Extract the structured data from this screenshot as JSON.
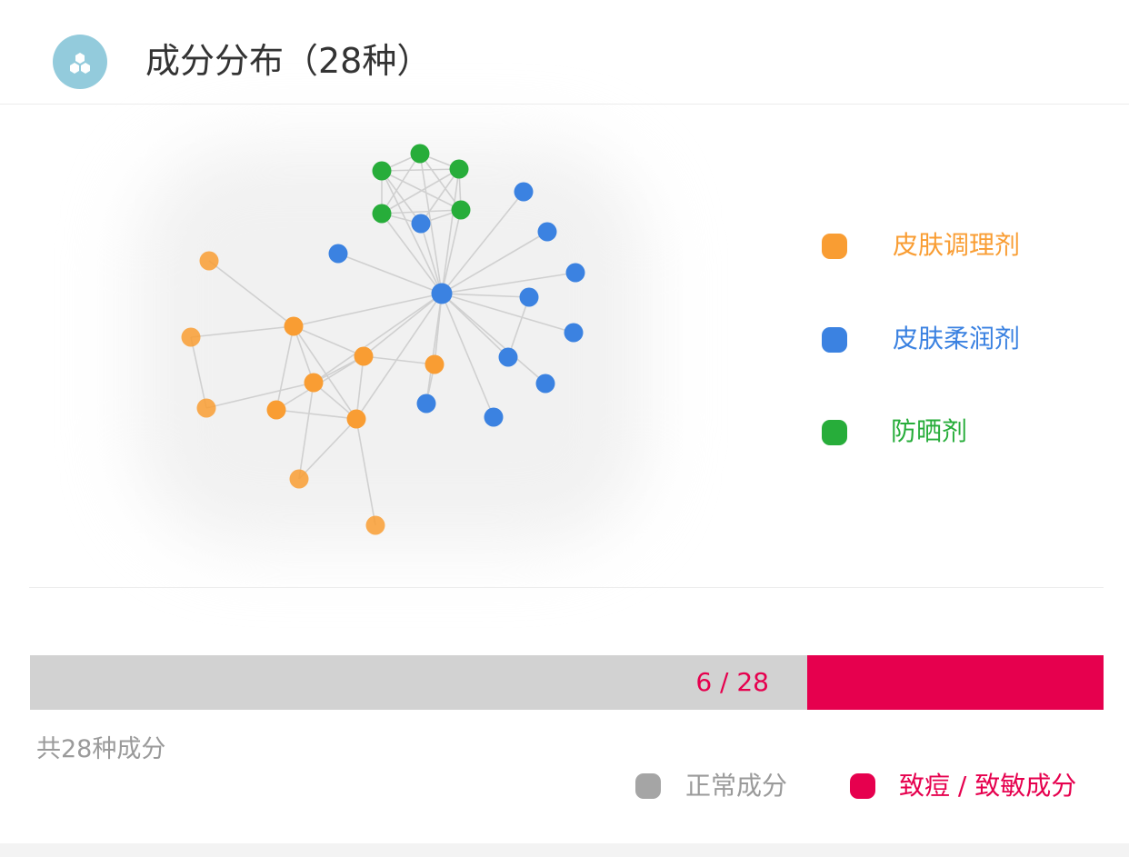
{
  "header": {
    "title": "成分分布（28种）",
    "icon": "molecule-icon"
  },
  "network": {
    "legend": [
      {
        "label": "皮肤调理剂",
        "color": "#f99d33"
      },
      {
        "label": "皮肤柔润剂",
        "color": "#3b82e1"
      },
      {
        "label": "防晒剂",
        "color": "#27ad3a"
      }
    ],
    "node_colors": {
      "orange": "#f99d33",
      "blue": "#3b82e1",
      "green": "#27ad3a",
      "edge": "#d0d0d0"
    }
  },
  "ratio": {
    "flagged": 6,
    "total": 28,
    "flagged_fraction": 0.2143,
    "text": "6 / 28",
    "normal_color": "#d2d2d2",
    "flagged_color": "#e6004e"
  },
  "summary": {
    "total_text": "共28种成分"
  },
  "bottom_legend": [
    {
      "label": "正常成分",
      "color": "#a5a5a5",
      "text_color": "#9a9a9a"
    },
    {
      "label": "致痘 / 致敏成分",
      "color": "#e6004e",
      "text_color": "#e6004e"
    }
  ]
}
